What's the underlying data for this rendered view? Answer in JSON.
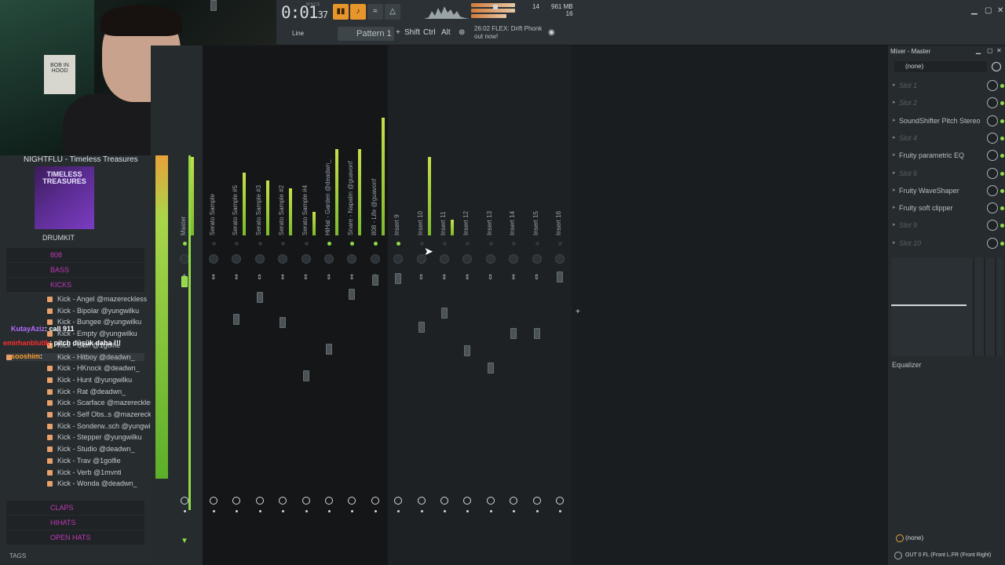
{
  "transport": {
    "time_main": "0:01",
    "time_sub": "37",
    "time_label": "M:S:CS",
    "cpu": "14",
    "voices": "16",
    "memory": "961 MB"
  },
  "toolbar": {
    "snap": "Line",
    "pattern": "Pattern 1",
    "shift": "Shift",
    "ctrl": "Ctrl",
    "alt": "Alt",
    "news_time": "26:02",
    "news_line1": "FLEX: Drift Phonk",
    "news_line2": "out now!"
  },
  "browser": {
    "now_playing": "NIGHTFLU - Timeless Treasures",
    "cover_text": "TIMELESS TREASURES",
    "drumkit": "DRUMKIT",
    "folders": [
      "808",
      "BASS",
      "KICKS",
      "CLAPS",
      "HIHATS",
      "OPEN HATS"
    ],
    "kicks": [
      "Kick - Angel @mazereckless",
      "Kick - Bipolar @yungwilku",
      "Kick - Bungee @yungwilku",
      "Kick - Empty @yungwilku",
      "Kick - Gurl @1golfie",
      "Kick - Hitboy @deadwn_",
      "Kick - HKnock @deadwn_",
      "Kick - Hunt @yungwilku",
      "Kick - Rat @deadwn_",
      "Kick - Scarface @mazereckless",
      "Kick - Self Obs..s @mazereckless",
      "Kick - Sonderw..sch @yungwilku",
      "Kick - Stepper @yungwilku",
      "Kick - Studio @deadwn_",
      "Kick - Trav @1golfie",
      "Kick - Verb @1mvnti",
      "Kick - Wonda @deadwn_"
    ],
    "tags": "TAGS"
  },
  "chat": [
    {
      "user": "KutayAziz",
      "msg": ": call 911",
      "color": "#b46bff"
    },
    {
      "user": "emirhanblutik",
      "msg": ": pitch düşük daha !!!",
      "color": "#ff2f2f"
    },
    {
      "user": "sooshim",
      "msg": ": ",
      "color": "#ff9e2c"
    }
  ],
  "mixer": {
    "tracks": [
      "Master",
      "Serato Sample",
      "Serato Sample #5",
      "Serato Sample #3",
      "Serato Sample #2",
      "Serato Sample #4",
      "HiHat - Garden @deadwn_",
      "Snare - Napalm @guavonf",
      "808 - Life @guavonf",
      "Insert 9",
      "Insert 10",
      "Insert 11",
      "Insert 12",
      "Insert 13",
      "Insert 14",
      "Insert 15",
      "Insert 16"
    ]
  },
  "master_panel": {
    "title": "Mixer - Master",
    "input": "(none)",
    "slots": [
      {
        "label": "Slot 1",
        "filled": false
      },
      {
        "label": "Slot 2",
        "filled": false
      },
      {
        "label": "SoundShifter Pitch Stereo",
        "filled": true
      },
      {
        "label": "Slot 4",
        "filled": false
      },
      {
        "label": "Fruity parametric EQ",
        "filled": true
      },
      {
        "label": "Slot 6",
        "filled": false
      },
      {
        "label": "Fruity WaveShaper",
        "filled": true
      },
      {
        "label": "Fruity soft clipper",
        "filled": true
      },
      {
        "label": "Slot 9",
        "filled": false
      },
      {
        "label": "Slot 10",
        "filled": false
      }
    ],
    "eq_label": "Equalizer",
    "output_none": "(none)",
    "output": "OUT 0 FL (Front L.FR (Front Right)"
  }
}
